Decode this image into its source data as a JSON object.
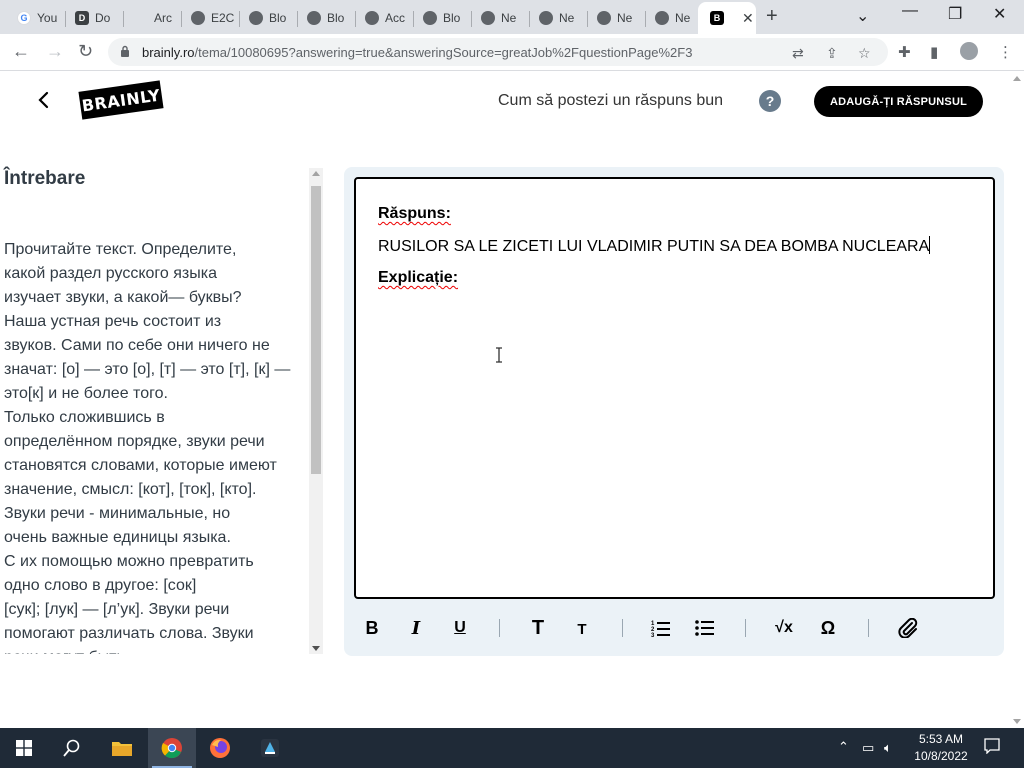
{
  "browser": {
    "tabs": [
      {
        "label": "You",
        "icon": "google-icon",
        "color": "#4285f4"
      },
      {
        "label": "Do",
        "icon": "document-icon",
        "color": "#3c4043"
      },
      {
        "label": "Arc",
        "icon": "blank-page-icon",
        "color": "#9aa0a6"
      },
      {
        "label": "E2C",
        "icon": "chrome-icon",
        "color": "#5f6368"
      },
      {
        "label": "Blo",
        "icon": "chrome-icon",
        "color": "#5f6368"
      },
      {
        "label": "Blo",
        "icon": "chrome-icon",
        "color": "#5f6368"
      },
      {
        "label": "Acc",
        "icon": "chrome-icon",
        "color": "#5f6368"
      },
      {
        "label": "Blo",
        "icon": "chrome-icon",
        "color": "#5f6368"
      },
      {
        "label": "Ne",
        "icon": "chrome-icon",
        "color": "#5f6368"
      },
      {
        "label": "Ne",
        "icon": "chrome-icon",
        "color": "#5f6368"
      },
      {
        "label": "Ne",
        "icon": "chrome-icon",
        "color": "#5f6368"
      },
      {
        "label": "Ne",
        "icon": "chrome-icon",
        "color": "#5f6368"
      }
    ],
    "active_tab_icon": "brainly-icon",
    "url_host": "brainly.ro",
    "url_path": "/tema/10080695?answering=true&answeringSource=greatJob%2FquestionPage%2F3"
  },
  "header": {
    "logo_text": "BRAINLY",
    "howto_link": "Cum să postezi un răspuns bun",
    "help_symbol": "?",
    "add_answer_button": "ADAUGĂ-ȚI RĂSPUNSUL"
  },
  "question": {
    "title": "Întrebare",
    "text": "Прочитайте текст. Определите,\nкакой раздел русского языка\nизучает звуки, а какой— буквы?\nНаша устная речь состоит из\nзвуков. Сами по себе они ничего не\nзначат: [о] — это [о], [т] — это [т], [к] —\nэто[к] и не более того.\nТолько сложившись в\nопределённом порядке, звуки речи\nстановятся словами, которые имеют\nзначение, смысл: [кот], [ток], [кто].\nЗвуки речи - минимальные, но\nочень важные единицы языка.\nС их помощью можно превратить\nодно слово в другое: [сок]\n[сук]; [лук] — [л’ук]. Звуки речи\nпомогают различать слова. Звуки\nречи могут быть"
  },
  "editor": {
    "answer_label": "Răspuns:",
    "answer_text": "RUSILOR SA LE ZICETI LUI VLADIMIR PUTIN SA DEA BOMBA NUCLEARA",
    "explanation_label": "Explicație:",
    "toolbar": [
      {
        "name": "bold-button",
        "glyph": "B"
      },
      {
        "name": "italic-button",
        "glyph": "I"
      },
      {
        "name": "underline-button",
        "glyph": "U"
      },
      {
        "name": "heading-large-button",
        "glyph": "T"
      },
      {
        "name": "heading-small-button",
        "glyph": "T"
      },
      {
        "name": "ordered-list-button",
        "glyph": "ordered-list-icon"
      },
      {
        "name": "bullet-list-button",
        "glyph": "bullet-list-icon"
      },
      {
        "name": "equation-button",
        "glyph": "√x"
      },
      {
        "name": "special-chars-button",
        "glyph": "Ω"
      },
      {
        "name": "attach-button",
        "glyph": "paperclip-icon"
      }
    ]
  },
  "taskbar": {
    "apps": [
      "start-icon",
      "search-icon",
      "file-explorer-icon",
      "chrome-icon",
      "firefox-icon",
      "brainly-app-icon"
    ],
    "time": "5:53 AM",
    "date": "10/8/2022"
  },
  "colors": {
    "brand_black": "#000000",
    "editor_bg": "#ebf2f7",
    "help_gray": "#687b8c",
    "taskbar": "#1f2a37"
  }
}
